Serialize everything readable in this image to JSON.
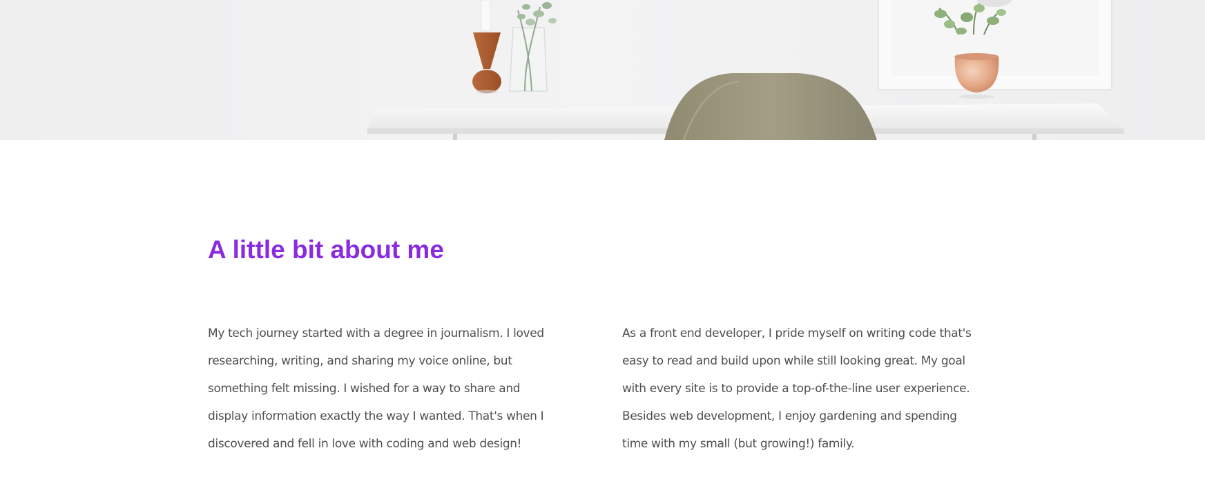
{
  "hero": {
    "image": "desk-with-chair-and-plants-photo"
  },
  "about": {
    "title": "A little bit about me",
    "title_color": "#8a2be2",
    "text_color": "#4f4f4f",
    "paragraph_left": "My tech journey started with a degree in journalism. I loved researching, writing, and sharing my voice online, but something felt missing. I wished for a way to share and display information exactly the way I wanted. That's when I discovered and fell in love with coding and web design!",
    "paragraph_right": "As a front end developer, I pride myself on writing code that's easy to read and build upon while still looking great. My goal with every site is to provide a top-of-the-line user experience. Besides web development, I enjoy gardening and spending time with my small (but growing!) family."
  }
}
